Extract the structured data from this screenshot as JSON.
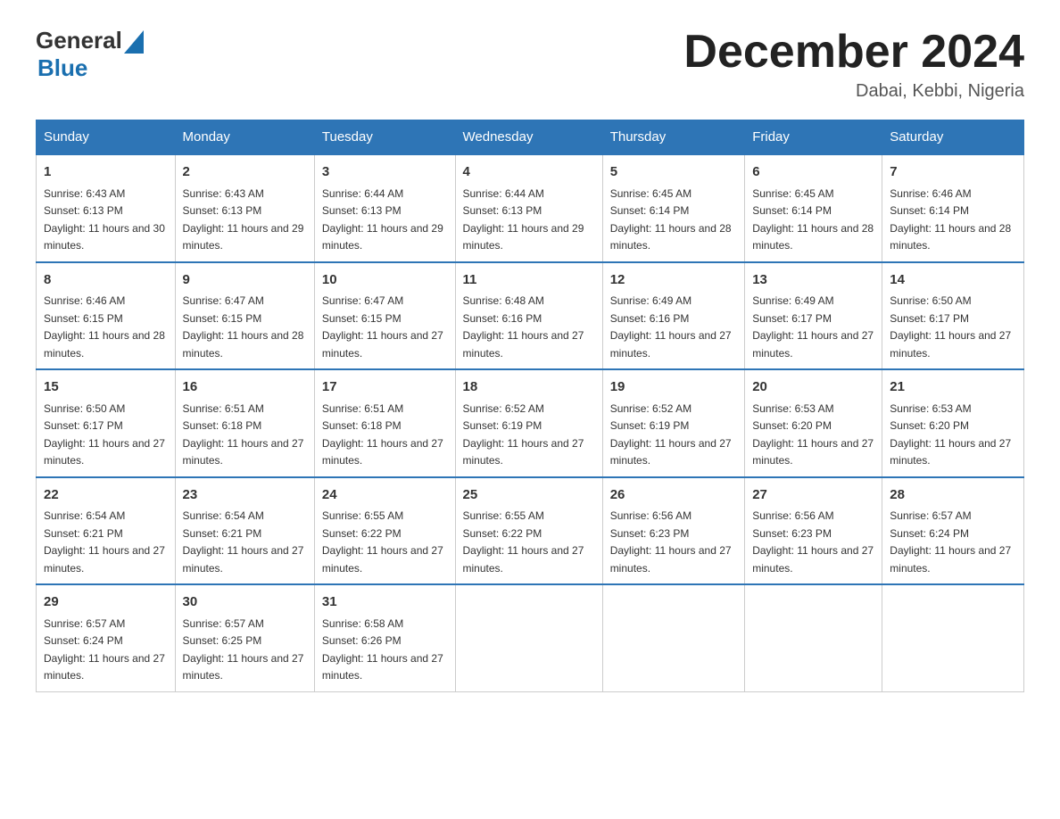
{
  "header": {
    "logo_general": "General",
    "logo_blue": "Blue",
    "main_title": "December 2024",
    "subtitle": "Dabai, Kebbi, Nigeria"
  },
  "calendar": {
    "days_of_week": [
      "Sunday",
      "Monday",
      "Tuesday",
      "Wednesday",
      "Thursday",
      "Friday",
      "Saturday"
    ],
    "weeks": [
      [
        {
          "day": "1",
          "sunrise": "6:43 AM",
          "sunset": "6:13 PM",
          "daylight": "11 hours and 30 minutes."
        },
        {
          "day": "2",
          "sunrise": "6:43 AM",
          "sunset": "6:13 PM",
          "daylight": "11 hours and 29 minutes."
        },
        {
          "day": "3",
          "sunrise": "6:44 AM",
          "sunset": "6:13 PM",
          "daylight": "11 hours and 29 minutes."
        },
        {
          "day": "4",
          "sunrise": "6:44 AM",
          "sunset": "6:13 PM",
          "daylight": "11 hours and 29 minutes."
        },
        {
          "day": "5",
          "sunrise": "6:45 AM",
          "sunset": "6:14 PM",
          "daylight": "11 hours and 28 minutes."
        },
        {
          "day": "6",
          "sunrise": "6:45 AM",
          "sunset": "6:14 PM",
          "daylight": "11 hours and 28 minutes."
        },
        {
          "day": "7",
          "sunrise": "6:46 AM",
          "sunset": "6:14 PM",
          "daylight": "11 hours and 28 minutes."
        }
      ],
      [
        {
          "day": "8",
          "sunrise": "6:46 AM",
          "sunset": "6:15 PM",
          "daylight": "11 hours and 28 minutes."
        },
        {
          "day": "9",
          "sunrise": "6:47 AM",
          "sunset": "6:15 PM",
          "daylight": "11 hours and 28 minutes."
        },
        {
          "day": "10",
          "sunrise": "6:47 AM",
          "sunset": "6:15 PM",
          "daylight": "11 hours and 27 minutes."
        },
        {
          "day": "11",
          "sunrise": "6:48 AM",
          "sunset": "6:16 PM",
          "daylight": "11 hours and 27 minutes."
        },
        {
          "day": "12",
          "sunrise": "6:49 AM",
          "sunset": "6:16 PM",
          "daylight": "11 hours and 27 minutes."
        },
        {
          "day": "13",
          "sunrise": "6:49 AM",
          "sunset": "6:17 PM",
          "daylight": "11 hours and 27 minutes."
        },
        {
          "day": "14",
          "sunrise": "6:50 AM",
          "sunset": "6:17 PM",
          "daylight": "11 hours and 27 minutes."
        }
      ],
      [
        {
          "day": "15",
          "sunrise": "6:50 AM",
          "sunset": "6:17 PM",
          "daylight": "11 hours and 27 minutes."
        },
        {
          "day": "16",
          "sunrise": "6:51 AM",
          "sunset": "6:18 PM",
          "daylight": "11 hours and 27 minutes."
        },
        {
          "day": "17",
          "sunrise": "6:51 AM",
          "sunset": "6:18 PM",
          "daylight": "11 hours and 27 minutes."
        },
        {
          "day": "18",
          "sunrise": "6:52 AM",
          "sunset": "6:19 PM",
          "daylight": "11 hours and 27 minutes."
        },
        {
          "day": "19",
          "sunrise": "6:52 AM",
          "sunset": "6:19 PM",
          "daylight": "11 hours and 27 minutes."
        },
        {
          "day": "20",
          "sunrise": "6:53 AM",
          "sunset": "6:20 PM",
          "daylight": "11 hours and 27 minutes."
        },
        {
          "day": "21",
          "sunrise": "6:53 AM",
          "sunset": "6:20 PM",
          "daylight": "11 hours and 27 minutes."
        }
      ],
      [
        {
          "day": "22",
          "sunrise": "6:54 AM",
          "sunset": "6:21 PM",
          "daylight": "11 hours and 27 minutes."
        },
        {
          "day": "23",
          "sunrise": "6:54 AM",
          "sunset": "6:21 PM",
          "daylight": "11 hours and 27 minutes."
        },
        {
          "day": "24",
          "sunrise": "6:55 AM",
          "sunset": "6:22 PM",
          "daylight": "11 hours and 27 minutes."
        },
        {
          "day": "25",
          "sunrise": "6:55 AM",
          "sunset": "6:22 PM",
          "daylight": "11 hours and 27 minutes."
        },
        {
          "day": "26",
          "sunrise": "6:56 AM",
          "sunset": "6:23 PM",
          "daylight": "11 hours and 27 minutes."
        },
        {
          "day": "27",
          "sunrise": "6:56 AM",
          "sunset": "6:23 PM",
          "daylight": "11 hours and 27 minutes."
        },
        {
          "day": "28",
          "sunrise": "6:57 AM",
          "sunset": "6:24 PM",
          "daylight": "11 hours and 27 minutes."
        }
      ],
      [
        {
          "day": "29",
          "sunrise": "6:57 AM",
          "sunset": "6:24 PM",
          "daylight": "11 hours and 27 minutes."
        },
        {
          "day": "30",
          "sunrise": "6:57 AM",
          "sunset": "6:25 PM",
          "daylight": "11 hours and 27 minutes."
        },
        {
          "day": "31",
          "sunrise": "6:58 AM",
          "sunset": "6:26 PM",
          "daylight": "11 hours and 27 minutes."
        },
        null,
        null,
        null,
        null
      ]
    ]
  }
}
